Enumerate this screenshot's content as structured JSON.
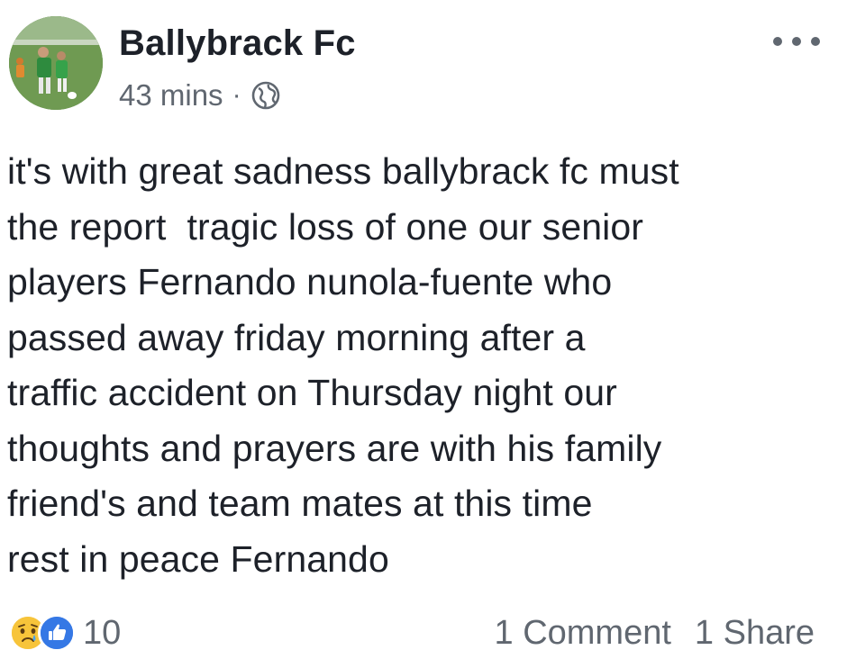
{
  "post": {
    "page_name": "Ballybrack Fc",
    "timestamp": "43 mins",
    "separator": "·",
    "privacy_icon": "globe-icon",
    "more_icon": "more-options-icon",
    "body_lines": [
      "it's with great sadness ballybrack fc must",
      "the report  tragic loss of one our senior",
      "players Fernando nunola-fuente who",
      "passed away friday morning after a",
      "traffic accident on Thursday night our",
      "thoughts and prayers are with his family",
      "friend's and team mates at this time",
      "rest in peace Fernando"
    ]
  },
  "footer": {
    "reaction_icons": [
      "sad-reaction-icon",
      "like-reaction-icon"
    ],
    "reaction_count": "10",
    "comments": "1 Comment",
    "shares": "1 Share"
  },
  "colors": {
    "text_primary": "#1d2129",
    "text_secondary": "#606770",
    "like_blue": "#3578e5",
    "sad_yellow": "#f7c43a"
  }
}
